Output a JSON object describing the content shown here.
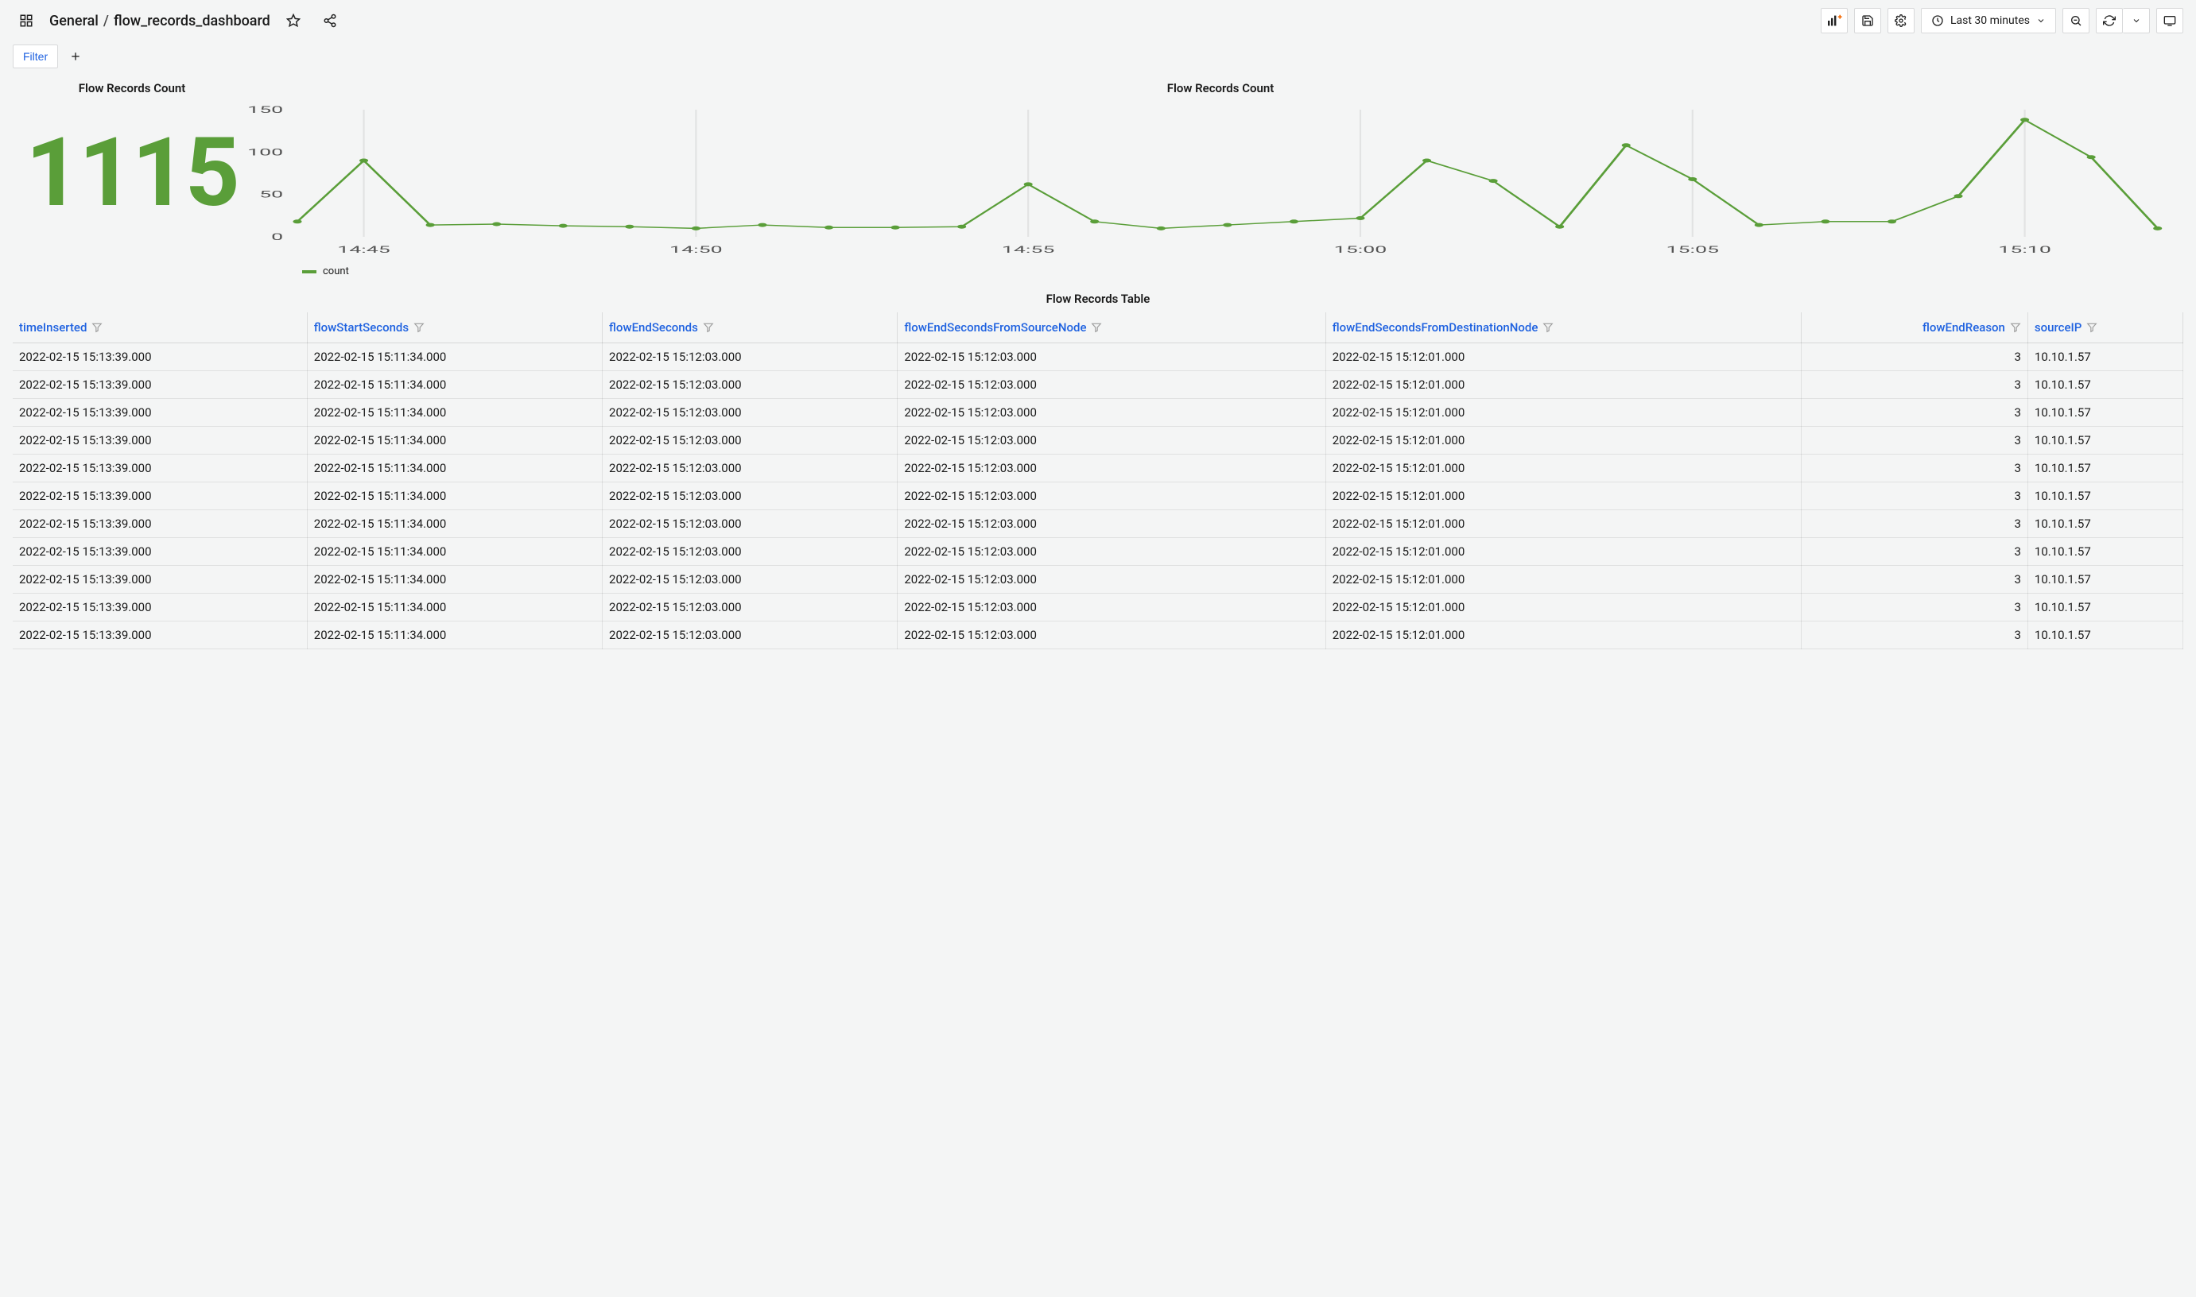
{
  "breadcrumb": {
    "folder": "General",
    "dashboard": "flow_records_dashboard"
  },
  "toolbar": {
    "time_range_label": "Last 30 minutes",
    "filter_label": "Filter"
  },
  "panels": {
    "stat": {
      "title": "Flow Records Count",
      "value": "1115"
    },
    "chart": {
      "title": "Flow Records Count",
      "legend_label": "count"
    },
    "table": {
      "title": "Flow Records Table"
    }
  },
  "chart_data": {
    "type": "line",
    "xlabel": "",
    "ylabel": "",
    "ylim": [
      0,
      150
    ],
    "yticks": [
      0,
      50,
      100,
      150
    ],
    "xticks": [
      "14:45",
      "14:50",
      "14:55",
      "15:00",
      "15:05",
      "15:10"
    ],
    "x_start_min": 44,
    "x_end_min": 72,
    "series": [
      {
        "name": "count",
        "color": "#5a9e39",
        "minutes": [
          44,
          45,
          46,
          47,
          48,
          49,
          50,
          51,
          52,
          53,
          54,
          55,
          56,
          57,
          58,
          59,
          60,
          61,
          62,
          63,
          64,
          65,
          66,
          67,
          68,
          69,
          70,
          71,
          72
        ],
        "values": [
          18,
          90,
          14,
          15,
          13,
          12,
          10,
          14,
          11,
          11,
          12,
          62,
          18,
          10,
          14,
          18,
          22,
          90,
          66,
          12,
          108,
          68,
          14,
          18,
          18,
          48,
          138,
          94,
          10
        ]
      }
    ]
  },
  "table": {
    "columns": [
      {
        "key": "timeInserted",
        "label": "timeInserted",
        "align": "left"
      },
      {
        "key": "flowStartSeconds",
        "label": "flowStartSeconds",
        "align": "left"
      },
      {
        "key": "flowEndSeconds",
        "label": "flowEndSeconds",
        "align": "left"
      },
      {
        "key": "flowEndSecondsFromSourceNode",
        "label": "flowEndSecondsFromSourceNode",
        "align": "left"
      },
      {
        "key": "flowEndSecondsFromDestinationNode",
        "label": "flowEndSecondsFromDestinationNode",
        "align": "left"
      },
      {
        "key": "flowEndReason",
        "label": "flowEndReason",
        "align": "right"
      },
      {
        "key": "sourceIP",
        "label": "sourceIP",
        "align": "left"
      }
    ],
    "rows": [
      {
        "timeInserted": "2022-02-15 15:13:39.000",
        "flowStartSeconds": "2022-02-15 15:11:34.000",
        "flowEndSeconds": "2022-02-15 15:12:03.000",
        "flowEndSecondsFromSourceNode": "2022-02-15 15:12:03.000",
        "flowEndSecondsFromDestinationNode": "2022-02-15 15:12:01.000",
        "flowEndReason": "3",
        "sourceIP": "10.10.1.57"
      },
      {
        "timeInserted": "2022-02-15 15:13:39.000",
        "flowStartSeconds": "2022-02-15 15:11:34.000",
        "flowEndSeconds": "2022-02-15 15:12:03.000",
        "flowEndSecondsFromSourceNode": "2022-02-15 15:12:03.000",
        "flowEndSecondsFromDestinationNode": "2022-02-15 15:12:01.000",
        "flowEndReason": "3",
        "sourceIP": "10.10.1.57"
      },
      {
        "timeInserted": "2022-02-15 15:13:39.000",
        "flowStartSeconds": "2022-02-15 15:11:34.000",
        "flowEndSeconds": "2022-02-15 15:12:03.000",
        "flowEndSecondsFromSourceNode": "2022-02-15 15:12:03.000",
        "flowEndSecondsFromDestinationNode": "2022-02-15 15:12:01.000",
        "flowEndReason": "3",
        "sourceIP": "10.10.1.57"
      },
      {
        "timeInserted": "2022-02-15 15:13:39.000",
        "flowStartSeconds": "2022-02-15 15:11:34.000",
        "flowEndSeconds": "2022-02-15 15:12:03.000",
        "flowEndSecondsFromSourceNode": "2022-02-15 15:12:03.000",
        "flowEndSecondsFromDestinationNode": "2022-02-15 15:12:01.000",
        "flowEndReason": "3",
        "sourceIP": "10.10.1.57"
      },
      {
        "timeInserted": "2022-02-15 15:13:39.000",
        "flowStartSeconds": "2022-02-15 15:11:34.000",
        "flowEndSeconds": "2022-02-15 15:12:03.000",
        "flowEndSecondsFromSourceNode": "2022-02-15 15:12:03.000",
        "flowEndSecondsFromDestinationNode": "2022-02-15 15:12:01.000",
        "flowEndReason": "3",
        "sourceIP": "10.10.1.57"
      },
      {
        "timeInserted": "2022-02-15 15:13:39.000",
        "flowStartSeconds": "2022-02-15 15:11:34.000",
        "flowEndSeconds": "2022-02-15 15:12:03.000",
        "flowEndSecondsFromSourceNode": "2022-02-15 15:12:03.000",
        "flowEndSecondsFromDestinationNode": "2022-02-15 15:12:01.000",
        "flowEndReason": "3",
        "sourceIP": "10.10.1.57"
      },
      {
        "timeInserted": "2022-02-15 15:13:39.000",
        "flowStartSeconds": "2022-02-15 15:11:34.000",
        "flowEndSeconds": "2022-02-15 15:12:03.000",
        "flowEndSecondsFromSourceNode": "2022-02-15 15:12:03.000",
        "flowEndSecondsFromDestinationNode": "2022-02-15 15:12:01.000",
        "flowEndReason": "3",
        "sourceIP": "10.10.1.57"
      },
      {
        "timeInserted": "2022-02-15 15:13:39.000",
        "flowStartSeconds": "2022-02-15 15:11:34.000",
        "flowEndSeconds": "2022-02-15 15:12:03.000",
        "flowEndSecondsFromSourceNode": "2022-02-15 15:12:03.000",
        "flowEndSecondsFromDestinationNode": "2022-02-15 15:12:01.000",
        "flowEndReason": "3",
        "sourceIP": "10.10.1.57"
      },
      {
        "timeInserted": "2022-02-15 15:13:39.000",
        "flowStartSeconds": "2022-02-15 15:11:34.000",
        "flowEndSeconds": "2022-02-15 15:12:03.000",
        "flowEndSecondsFromSourceNode": "2022-02-15 15:12:03.000",
        "flowEndSecondsFromDestinationNode": "2022-02-15 15:12:01.000",
        "flowEndReason": "3",
        "sourceIP": "10.10.1.57"
      },
      {
        "timeInserted": "2022-02-15 15:13:39.000",
        "flowStartSeconds": "2022-02-15 15:11:34.000",
        "flowEndSeconds": "2022-02-15 15:12:03.000",
        "flowEndSecondsFromSourceNode": "2022-02-15 15:12:03.000",
        "flowEndSecondsFromDestinationNode": "2022-02-15 15:12:01.000",
        "flowEndReason": "3",
        "sourceIP": "10.10.1.57"
      },
      {
        "timeInserted": "2022-02-15 15:13:39.000",
        "flowStartSeconds": "2022-02-15 15:11:34.000",
        "flowEndSeconds": "2022-02-15 15:12:03.000",
        "flowEndSecondsFromSourceNode": "2022-02-15 15:12:03.000",
        "flowEndSecondsFromDestinationNode": "2022-02-15 15:12:01.000",
        "flowEndReason": "3",
        "sourceIP": "10.10.1.57"
      }
    ]
  }
}
